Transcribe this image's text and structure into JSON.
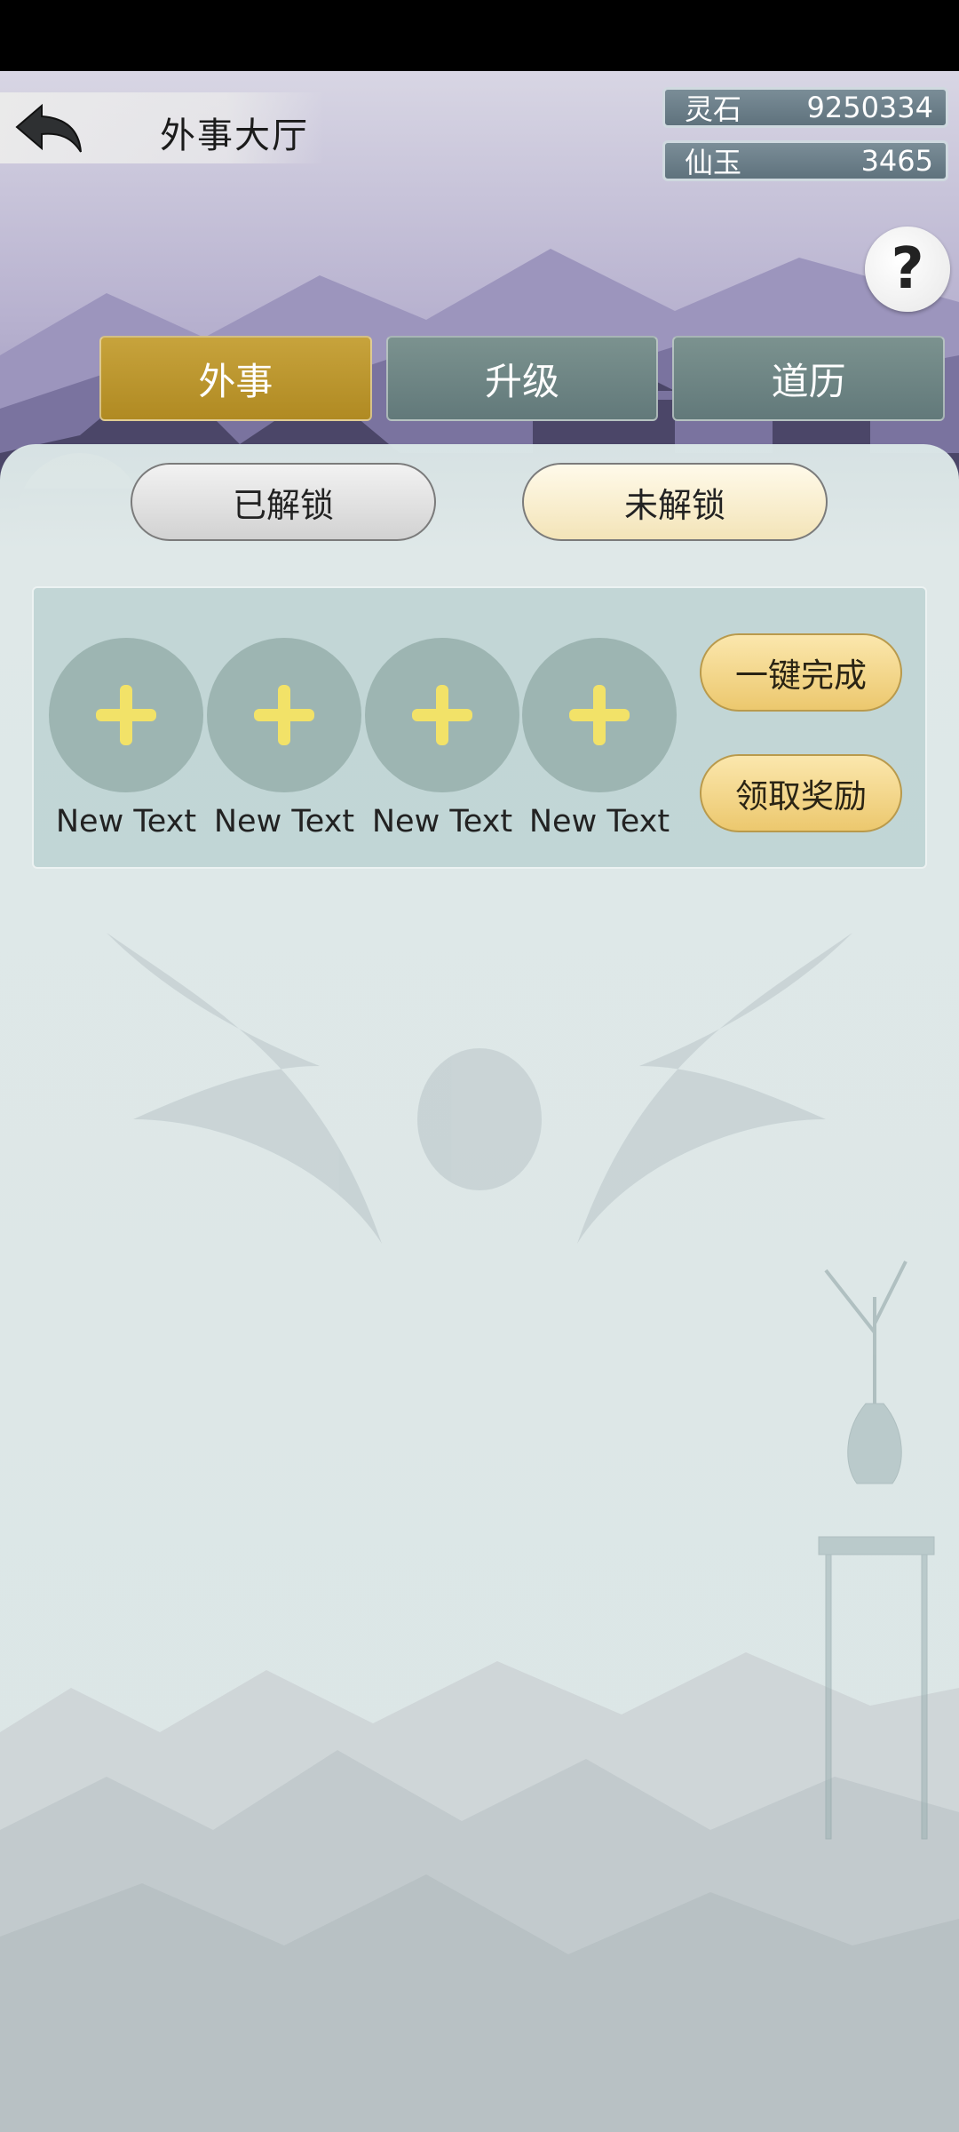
{
  "header": {
    "title": "外事大厅",
    "back_icon": "back-arrow-icon"
  },
  "resources": [
    {
      "label": "灵石",
      "value": "9250334"
    },
    {
      "label": "仙玉",
      "value": "3465"
    }
  ],
  "help": {
    "label": "?"
  },
  "tabs": [
    {
      "label": "外事",
      "active": true
    },
    {
      "label": "升级",
      "active": false
    },
    {
      "label": "道历",
      "active": false
    }
  ],
  "filters": {
    "unlocked": "已解锁",
    "locked": "未解锁"
  },
  "slots": [
    {
      "label": "New Text",
      "icon": "plus-icon"
    },
    {
      "label": "New Text",
      "icon": "plus-icon"
    },
    {
      "label": "New Text",
      "icon": "plus-icon"
    },
    {
      "label": "New Text",
      "icon": "plus-icon"
    }
  ],
  "actions": {
    "complete_all": "一键完成",
    "claim_rewards": "领取奖励"
  },
  "colors": {
    "tab_active": "#c7a33c",
    "tab_inactive": "#6b8382",
    "panel_bg": "#dbe6e6",
    "gold_button": "#f0d07f"
  }
}
